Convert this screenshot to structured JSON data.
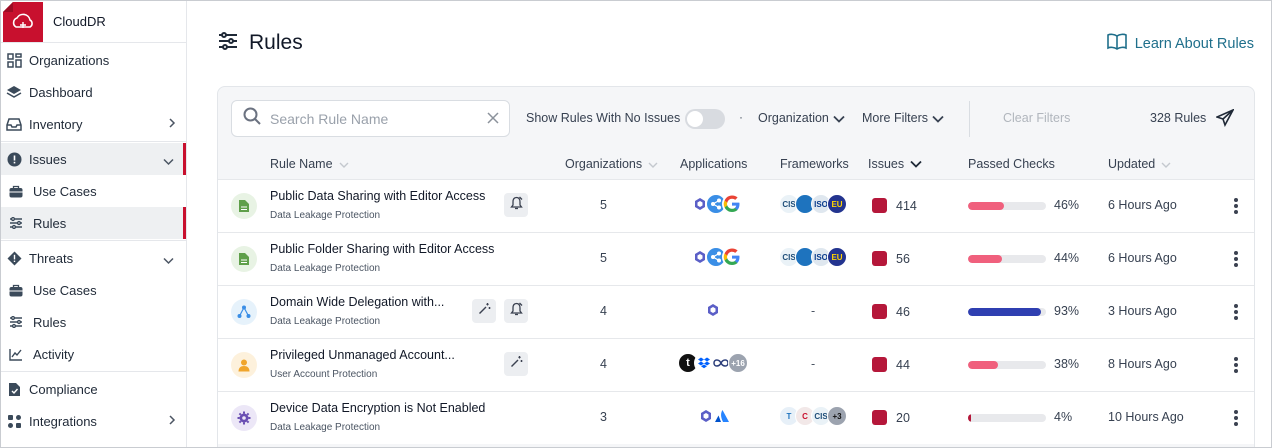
{
  "app": {
    "name": "CloudDR"
  },
  "sidebar": {
    "items": [
      {
        "label": "Organizations",
        "icon": "grid-icon"
      },
      {
        "label": "Dashboard",
        "icon": "layers-icon"
      },
      {
        "label": "Inventory",
        "icon": "inbox-icon"
      },
      {
        "label": "Issues",
        "icon": "alert-icon"
      },
      {
        "label": "Use Cases",
        "icon": "briefcase-icon"
      },
      {
        "label": "Rules",
        "icon": "sliders-icon"
      },
      {
        "label": "Threats",
        "icon": "threat-icon"
      },
      {
        "label": "Use Cases",
        "icon": "briefcase-icon"
      },
      {
        "label": "Rules",
        "icon": "sliders-icon"
      },
      {
        "label": "Activity",
        "icon": "activity-chart-icon"
      },
      {
        "label": "Compliance",
        "icon": "compliance-icon"
      },
      {
        "label": "Integrations",
        "icon": "integrations-icon"
      }
    ]
  },
  "page": {
    "title": "Rules",
    "learn_link": "Learn About Rules"
  },
  "toolbar": {
    "search_placeholder": "Search Rule Name",
    "toggle_label": "Show Rules With No Issues",
    "toggle_on": false,
    "separator": "·",
    "organization_filter": "Organization",
    "more_filters": "More Filters",
    "clear_filters": "Clear Filters",
    "rule_count": "328 Rules"
  },
  "table": {
    "columns": [
      "Rule Name",
      "Organizations",
      "Applications",
      "Frameworks",
      "Issues",
      "Passed Checks",
      "Updated"
    ],
    "rows": [
      {
        "name": "Public Data Sharing with Editor Access",
        "category": "Data Leakage Protection",
        "organizations": "5",
        "applications": [
          "office-icon",
          "share-icon",
          "google-icon"
        ],
        "frameworks": [
          "CIS",
          "",
          "ISO",
          "EU"
        ],
        "frameworks_extra": "",
        "issues": "414",
        "passed": "46%",
        "passed_value": 46,
        "updated": "6 Hours Ago",
        "icon": "document-icon",
        "actions": [
          "notify-icon"
        ]
      },
      {
        "name": "Public Folder Sharing with Editor Access",
        "category": "Data Leakage Protection",
        "organizations": "5",
        "applications": [
          "office-icon",
          "share-icon",
          "google-icon"
        ],
        "frameworks": [
          "CIS",
          "",
          "ISO",
          "EU"
        ],
        "frameworks_extra": "",
        "issues": "56",
        "passed": "44%",
        "passed_value": 44,
        "updated": "6 Hours Ago",
        "icon": "document-icon",
        "actions": []
      },
      {
        "name": "Domain Wide Delegation with...",
        "category": "Data Leakage Protection",
        "organizations": "4",
        "applications": [
          "office-icon"
        ],
        "frameworks": [],
        "frameworks_extra": "-",
        "issues": "46",
        "passed": "93%",
        "passed_value": 93,
        "updated": "3 Hours Ago",
        "icon": "delegation-icon",
        "actions": [
          "magic-wand-icon",
          "notify-icon"
        ]
      },
      {
        "name": "Privileged Unmanaged Account...",
        "category": "User Account Protection",
        "organizations": "4",
        "applications": [
          "t",
          "dropbox-icon",
          "infinity-icon",
          "+16"
        ],
        "frameworks": [],
        "frameworks_extra": "-",
        "issues": "44",
        "passed": "38%",
        "passed_value": 38,
        "updated": "8 Hours Ago",
        "icon": "user-icon",
        "actions": [
          "magic-wand-icon"
        ]
      },
      {
        "name": "Device Data Encryption is Not Enabled",
        "category": "Data Leakage Protection",
        "organizations": "3",
        "applications": [
          "office-icon",
          "atlassian-icon"
        ],
        "frameworks": [
          "T",
          "C",
          "CIS",
          "+3"
        ],
        "frameworks_extra": "",
        "issues": "20",
        "passed": "4%",
        "passed_value": 4,
        "updated": "10 Hours Ago",
        "icon": "gear-icon",
        "actions": []
      }
    ]
  },
  "colors": {
    "accent": "#c8102e",
    "link": "#1f6f8b",
    "bar_low": "#f0607d",
    "bar_high": "#2f3fb1",
    "issue": "#b5173a"
  }
}
